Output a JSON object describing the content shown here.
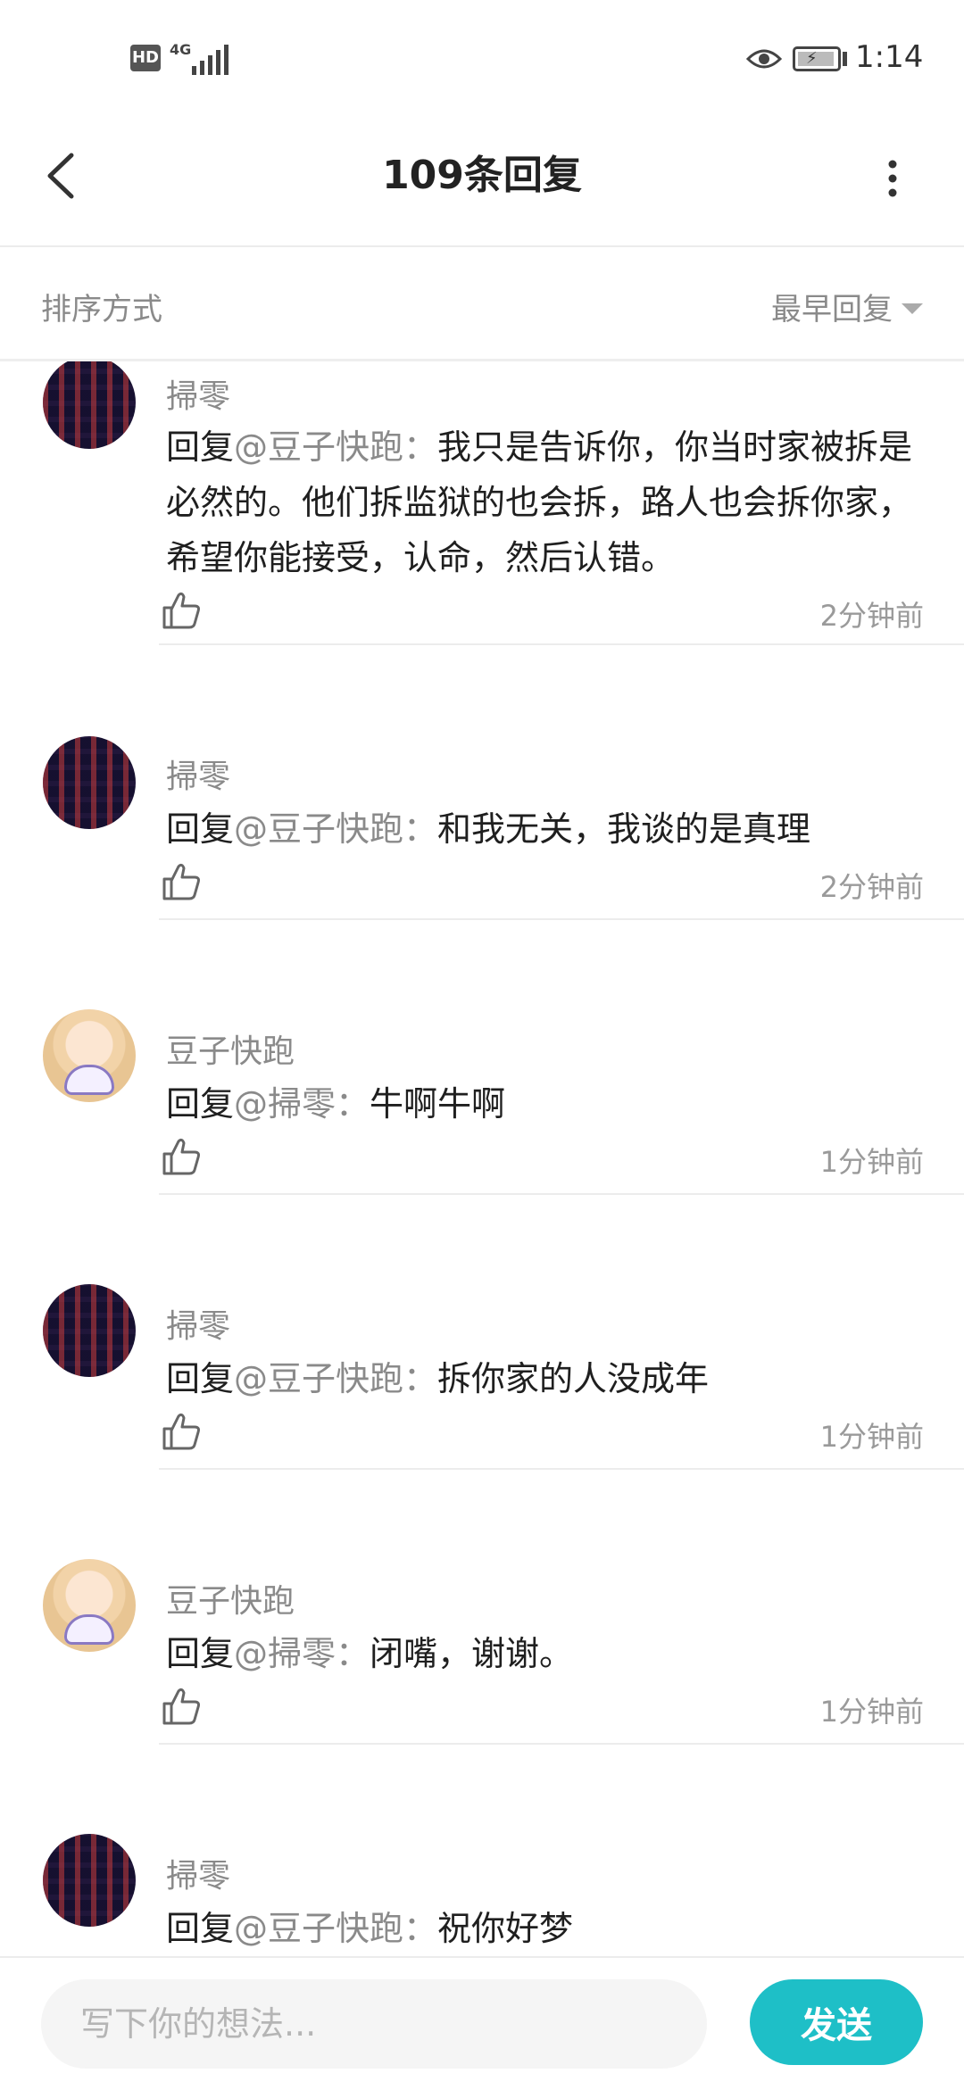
{
  "status_bar": {
    "hd_badge": "HD",
    "network": "4G",
    "time": "1:14",
    "icons": [
      "signal-icon",
      "eye-icon",
      "battery-charging-icon"
    ]
  },
  "header": {
    "title": "109条回复",
    "icons": [
      "back-icon",
      "more-icon"
    ]
  },
  "sort": {
    "label": "排序方式",
    "selected": "最早回复"
  },
  "replies": [
    {
      "username": "掃零",
      "prefix": "回复",
      "mention": "@豆子快跑",
      "separator": "：",
      "text": "我只是告诉你，你当时家被拆是必然的。他们拆监狱的也会拆，路人也会拆你家，希望你能接受，认命，然后认错。",
      "time": "2分钟前"
    },
    {
      "username": "掃零",
      "prefix": "回复",
      "mention": "@豆子快跑",
      "separator": "：",
      "text": "和我无关，我谈的是真理",
      "time": "2分钟前"
    },
    {
      "username": "豆子快跑",
      "prefix": "回复",
      "mention": "@掃零",
      "separator": "：",
      "text": "牛啊牛啊",
      "time": "1分钟前"
    },
    {
      "username": "掃零",
      "prefix": "回复",
      "mention": "@豆子快跑",
      "separator": "：",
      "text": "拆你家的人没成年",
      "time": "1分钟前"
    },
    {
      "username": "豆子快跑",
      "prefix": "回复",
      "mention": "@掃零",
      "separator": "：",
      "text": "闭嘴，谢谢。",
      "time": "1分钟前"
    },
    {
      "username": "掃零",
      "prefix": "回复",
      "mention": "@豆子快跑",
      "separator": "：",
      "text": "祝你好梦",
      "time": ""
    }
  ],
  "composer": {
    "placeholder": "写下你的想法...",
    "send_label": "发送"
  },
  "colors": {
    "accent": "#1ebfc7",
    "muted_text": "#8a8a8a",
    "divider": "#ececec"
  }
}
